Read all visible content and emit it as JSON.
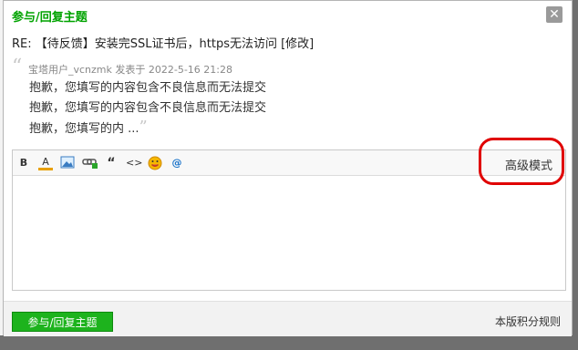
{
  "dialog": {
    "title": "参与/回复主题",
    "close_symbol": "✕"
  },
  "subject": "RE: 【待反馈】安装完SSL证书后，https无法访问 [修改]",
  "quote": {
    "meta": "宝塔用户_vcnzmk 发表于 2022-5-16 21:28",
    "lines": [
      "抱歉，您填写的内容包含不良信息而无法提交",
      "抱歉，您填写的内容包含不良信息而无法提交",
      "抱歉，您填写的内 ..."
    ]
  },
  "toolbar": {
    "bold": "B",
    "font_color": "A",
    "quote": "“",
    "code": "<>",
    "emoji": "☻",
    "at": "@",
    "advanced_mode": "高级模式"
  },
  "footer": {
    "submit": "参与/回复主题",
    "rules": "本版积分规则"
  },
  "colors": {
    "accent": "#1db31d",
    "highlight": "#e00000"
  }
}
